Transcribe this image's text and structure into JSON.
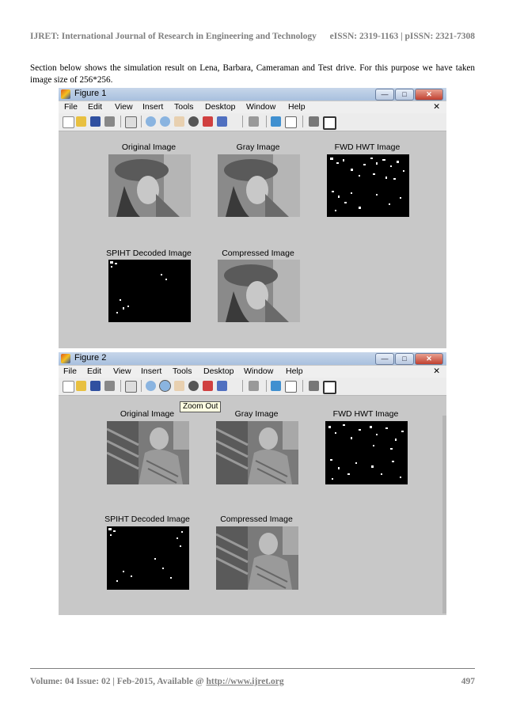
{
  "header": {
    "journal": "IJRET: International Journal of Research in Engineering and Technology",
    "issn": "eISSN: 2319-1163 | pISSN: 2321-7308"
  },
  "paragraph": "Section below shows the simulation result on Lena, Barbara, Cameraman and Test drive. For this purpose we have taken image size of 256*256.",
  "menu": [
    "File",
    "Edit",
    "View",
    "Insert",
    "Tools",
    "Desktop",
    "Window",
    "Help"
  ],
  "menu_close": "✕",
  "window_buttons": {
    "minimize": "—",
    "maximize": "□",
    "close": "✕"
  },
  "figure1": {
    "title": "Figure 1",
    "captions": {
      "original": "Original Image",
      "gray": "Gray Image",
      "fwd": "FWD HWT Image",
      "spiht": "SPIHT Decoded Image",
      "compressed": "Compressed Image"
    }
  },
  "figure2": {
    "title": "Figure 2",
    "tooltip": "Zoom Out",
    "captions": {
      "original": "Original Image",
      "gray": "Gray Image",
      "fwd": "FWD HWT Image",
      "spiht": "SPIHT Decoded Image",
      "compressed": "Compressed Image"
    }
  },
  "footer": {
    "volume": "Volume: 04 Issue: 02 | Feb-2015, Available @ ",
    "link": "http://www.ijret.org",
    "page": "497"
  },
  "icons": [
    "new-file-icon",
    "open-folder-icon",
    "save-icon",
    "print-icon",
    "pointer-icon",
    "zoom-in-icon",
    "zoom-out-icon",
    "pan-hand-icon",
    "rotate-3d-icon",
    "data-cursor-icon",
    "brush-icon",
    "link-plot-icon",
    "colorbar-icon",
    "legend-icon",
    "hide-plot-tools-icon",
    "show-plot-tools-icon"
  ]
}
